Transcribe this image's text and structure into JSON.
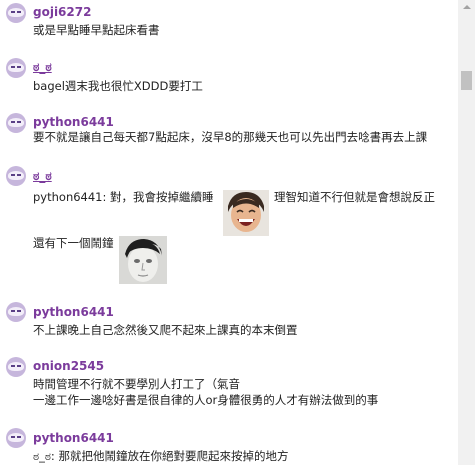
{
  "messages": [
    {
      "name": "goji6272",
      "lines": [
        "或是早點睡早點起床看書"
      ]
    },
    {
      "name": "ಠ_ಠ",
      "lines": [
        "bagel週末我也很忙XDDD要打工"
      ]
    },
    {
      "name": "python6441",
      "lines": [
        "要不就是讓自己每天都7點起床，沒早8的那幾天也可以先出門去唸書再去上課"
      ]
    },
    {
      "name": "ಠ_ಠ",
      "lines": [
        "python6441: 對，我會按掉繼續睡",
        "理智知道不行但就是會想說反正",
        "還有下一個鬧鐘"
      ],
      "sticker1": "laughing-man-sticker",
      "sticker2": "pale-face-sticker"
    },
    {
      "name": "python6441",
      "lines": [
        "不上課晚上自己念然後又爬不起來上課真的本末倒置"
      ]
    },
    {
      "name": "onion2545",
      "lines": [
        "時間管理不行就不要學別人打工了（氣音",
        "一邊工作一邊唸好書是很自律的人or身體很勇的人才有辦法做到的事"
      ]
    },
    {
      "name": "python6441",
      "lines": [
        "ಠ_ಠ: 那就把他鬧鐘放在你絕對要爬起來按掉的地方"
      ]
    }
  ]
}
